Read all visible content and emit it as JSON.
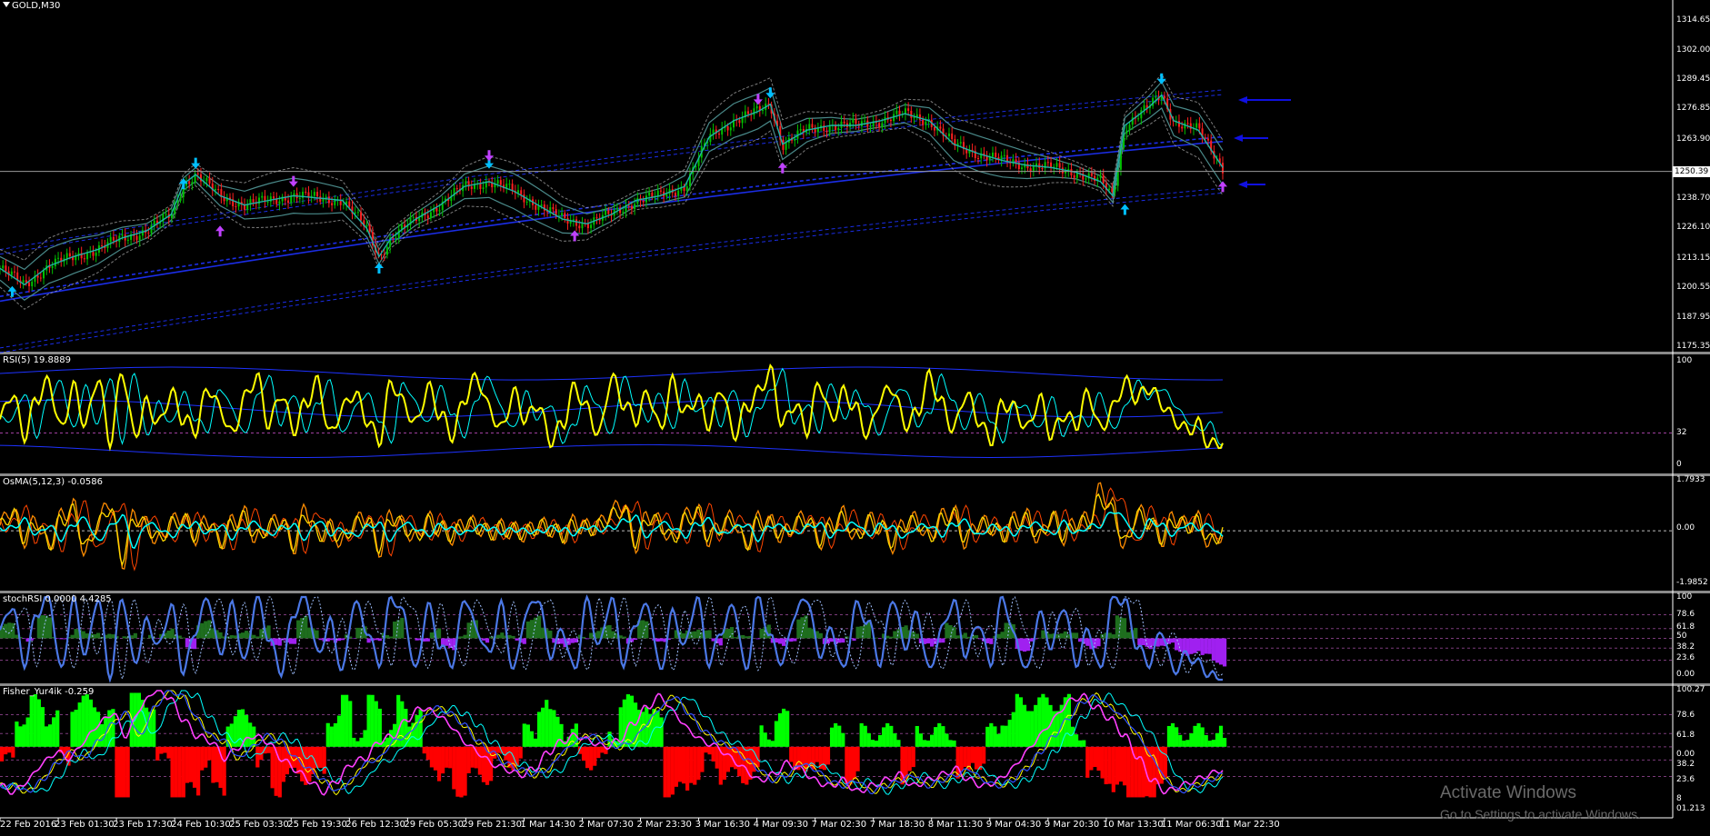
{
  "symbol_label": "GOLD,M30",
  "price_now_label": "1250.39",
  "watermark": {
    "line1": "Activate Windows",
    "line2": "Go to Settings to activate Windows."
  },
  "icons": {
    "symbol_menu": "triangle-down-icon",
    "arrow_up": "arrow-up-icon",
    "arrow_down": "arrow-down-icon",
    "blue_pointer": "arrow-left-icon"
  },
  "colors": {
    "background": "#000000",
    "candle_up": "#00c000",
    "candle_down": "#ff2020",
    "rsi_line": "#ffff00",
    "signal_cyan": "#00ffff",
    "band_blue": "#1e32ff",
    "stoch_line": "#4b78e6",
    "stoch_hist_up": "#1e6e1e",
    "stoch_hist_down": "#a020f0",
    "fisher_hist_up": "#00ff00",
    "fisher_hist_down": "#ff0000",
    "osma_orange": "#ff8c00",
    "arrow_cyan": "#00bfff",
    "arrow_purple": "#c040ff"
  },
  "chart_data": [
    {
      "type": "candlestick",
      "name": "GOLD,M30",
      "ylim": [
        1175.35,
        1322
      ],
      "y_ticks": [
        "1314.65",
        "1302.00",
        "1289.45",
        "1276.85",
        "1263.90",
        "1250.39",
        "1238.70",
        "1226.10",
        "1213.15",
        "1200.55",
        "1187.95",
        "1175.35"
      ],
      "x_ticks": [
        "22 Feb 2016",
        "23 Feb 01:30",
        "23 Feb 17:30",
        "24 Feb 10:30",
        "25 Feb 03:30",
        "25 Feb 19:30",
        "26 Feb 12:30",
        "29 Feb 05:30",
        "29 Feb 21:30",
        "1 Mar 14:30",
        "2 Mar 07:30",
        "2 Mar 23:30",
        "3 Mar 16:30",
        "4 Mar 09:30",
        "7 Mar 02:30",
        "7 Mar 18:30",
        "8 Mar 11:30",
        "9 Mar 04:30",
        "9 Mar 20:30",
        "10 Mar 13:30",
        "11 Mar 06:30",
        "11 Mar 22:30"
      ],
      "close_path": [
        [
          0,
          1209
        ],
        [
          2,
          1202
        ],
        [
          4,
          1210
        ],
        [
          6,
          1214
        ],
        [
          8,
          1217
        ],
        [
          10,
          1222
        ],
        [
          12,
          1225
        ],
        [
          14,
          1232
        ],
        [
          15,
          1245
        ],
        [
          16,
          1249
        ],
        [
          18,
          1240
        ],
        [
          20,
          1236
        ],
        [
          22,
          1238
        ],
        [
          24,
          1240
        ],
        [
          26,
          1239
        ],
        [
          28,
          1238
        ],
        [
          30,
          1226
        ],
        [
          31,
          1214
        ],
        [
          32,
          1222
        ],
        [
          34,
          1230
        ],
        [
          36,
          1236
        ],
        [
          38,
          1244
        ],
        [
          40,
          1246
        ],
        [
          42,
          1242
        ],
        [
          44,
          1236
        ],
        [
          46,
          1230
        ],
        [
          48,
          1228
        ],
        [
          50,
          1232
        ],
        [
          52,
          1238
        ],
        [
          54,
          1240
        ],
        [
          56,
          1244
        ],
        [
          58,
          1265
        ],
        [
          60,
          1272
        ],
        [
          62,
          1276
        ],
        [
          63,
          1279
        ],
        [
          64,
          1262
        ],
        [
          66,
          1268
        ],
        [
          68,
          1270
        ],
        [
          70,
          1270
        ],
        [
          72,
          1272
        ],
        [
          74,
          1275
        ],
        [
          76,
          1272
        ],
        [
          78,
          1262
        ],
        [
          80,
          1258
        ],
        [
          82,
          1255
        ],
        [
          84,
          1253
        ],
        [
          86,
          1252
        ],
        [
          88,
          1250
        ],
        [
          90,
          1246
        ],
        [
          91,
          1240
        ],
        [
          92,
          1270
        ],
        [
          94,
          1278
        ],
        [
          95,
          1283
        ],
        [
          96,
          1272
        ],
        [
          98,
          1268
        ],
        [
          99,
          1260
        ],
        [
          100,
          1252
        ]
      ],
      "up_arrows": [
        [
          1,
          1203
        ],
        [
          15,
          1249
        ],
        [
          31,
          1213
        ],
        [
          92,
          1238
        ]
      ],
      "down_arrows": [
        [
          16,
          1250
        ],
        [
          40,
          1250
        ],
        [
          63,
          1280
        ],
        [
          95,
          1286
        ]
      ],
      "purple_up": [
        [
          18,
          1228
        ],
        [
          47,
          1226
        ],
        [
          64,
          1255
        ],
        [
          100,
          1247
        ]
      ],
      "purple_down": [
        [
          24,
          1243
        ],
        [
          40,
          1254
        ],
        [
          62,
          1278
        ]
      ]
    },
    {
      "type": "line",
      "name": "RSI(5)",
      "label": "RSI(5) 19.8889",
      "ylim": [
        0,
        100
      ],
      "y_ticks": [
        "100",
        "32",
        "0"
      ],
      "levels": [
        32
      ],
      "series": [
        {
          "values": [
            45,
            70,
            30,
            65,
            80,
            35,
            75,
            40,
            85,
            25,
            90,
            30,
            60,
            40,
            70,
            45,
            35,
            75,
            55,
            30,
            65,
            85,
            40,
            70,
            35,
            60,
            80,
            30,
            55,
            70,
            45,
            25,
            80,
            60,
            40,
            75,
            50,
            30,
            65,
            85,
            55,
            35,
            70,
            45,
            60,
            25,
            40,
            75,
            55,
            30,
            85,
            60,
            45,
            70,
            35,
            80,
            50,
            65,
            40,
            75,
            30,
            55,
            70,
            90,
            40,
            60,
            35,
            80,
            45,
            70,
            55,
            30,
            65,
            75,
            40,
            50,
            85,
            60,
            35,
            70,
            45,
            25,
            60,
            55,
            35,
            65,
            30,
            50,
            40,
            70,
            35,
            55,
            80,
            65,
            75,
            60,
            45,
            35,
            40,
            20,
            25
          ]
        }
      ]
    },
    {
      "type": "line",
      "name": "OsMA(5,12,3)",
      "label": "OsMA(5,12,3) -0.0586",
      "ylim": [
        -1.9852,
        1.7933
      ],
      "y_ticks": [
        "1.7933",
        "0.00",
        "-1.9852"
      ],
      "levels": [
        0
      ],
      "series": [
        {
          "values": [
            0.2,
            0.8,
            -0.3,
            0.4,
            -0.6,
            0.5,
            0.9,
            -0.8,
            0.3,
            1.1,
            -1.2,
            0.6,
            0.2,
            -0.4,
            0.3,
            0.5,
            -0.2,
            0.4,
            -0.5,
            0.3,
            0.6,
            -0.3,
            0.2,
            0.4,
            -0.6,
            0.8,
            -0.2,
            0.1,
            -0.4,
            0.3,
            0.5,
            -0.7,
            0.6,
            0.2,
            -0.3,
            0.4,
            0.1,
            -0.2,
            0.3,
            0.2,
            -0.1,
            0.1,
            0.0,
            -0.1,
            0.2,
            0.1,
            -0.2,
            0.3,
            0.1,
            0.2,
            0.7,
            1.0,
            -0.5,
            0.6,
            0.3,
            -0.4,
            0.5,
            0.8,
            -0.3,
            0.2,
            0.5,
            -0.6,
            0.4,
            0.3,
            -0.2,
            0.3,
            0.5,
            -0.4,
            0.2,
            0.6,
            -0.3,
            0.4,
            0.2,
            -0.5,
            0.3,
            0.4,
            -0.3,
            0.5,
            0.7,
            -0.4,
            0.3,
            0.2,
            -0.2,
            0.4,
            0.5,
            -0.3,
            0.6,
            -0.2,
            0.3,
            0.4,
            1.5,
            0.9,
            -0.6,
            0.7,
            0.4,
            -0.3,
            0.5,
            0.2,
            0.4,
            -0.5,
            -0.06
          ]
        }
      ]
    },
    {
      "type": "line",
      "name": "stochRSI",
      "label": "stochRSI 0.0000 4.4285",
      "ylim": [
        0,
        100
      ],
      "y_ticks": [
        "100",
        "78.6",
        "61.8",
        "50",
        "38.2",
        "23.6",
        "0.00"
      ],
      "levels": [
        78.6,
        61.8,
        50,
        38.2,
        23.6
      ],
      "series": [
        {
          "values": [
            60,
            90,
            20,
            80,
            100,
            10,
            95,
            30,
            100,
            5,
            100,
            20,
            70,
            40,
            90,
            10,
            60,
            100,
            30,
            90,
            20,
            100,
            50,
            10,
            80,
            100,
            30,
            70,
            10,
            95,
            60,
            20,
            100,
            80,
            10,
            90,
            40,
            20,
            100,
            60,
            30,
            90,
            10,
            80,
            100,
            30,
            60,
            10,
            95,
            40,
            100,
            20,
            70,
            90,
            10,
            80,
            40,
            100,
            20,
            60,
            90,
            10,
            100,
            50,
            20,
            80,
            100,
            30,
            60,
            10,
            90,
            70,
            20,
            100,
            40,
            80,
            10,
            60,
            95,
            30,
            70,
            20,
            100,
            50,
            10,
            80,
            40,
            90,
            20,
            60,
            10,
            100,
            95,
            40,
            20,
            60,
            10,
            30,
            20,
            5,
            0
          ]
        }
      ]
    },
    {
      "type": "line",
      "name": "Fisher_Yur4ik",
      "label": "Fisher_Yur4ik -0.259",
      "ylim": [
        -10,
        100
      ],
      "y_ticks": [
        "100.27",
        "78.6",
        "61.8",
        "0.00",
        "38.2",
        "23.6",
        "8",
        "01.213"
      ],
      "levels": [
        78.6,
        61.8,
        50,
        38.2,
        23.6
      ],
      "series": [
        {
          "values": [
            15,
            10,
            20,
            35,
            45,
            40,
            55,
            70,
            80,
            60,
            85,
            100,
            95,
            75,
            60,
            55,
            40,
            50,
            60,
            55,
            40,
            30,
            20,
            10,
            20,
            35,
            40,
            55,
            60,
            75,
            85,
            80,
            70,
            55,
            45,
            35,
            30,
            25,
            30,
            45,
            55,
            60,
            55,
            50,
            55,
            70,
            85,
            95,
            80,
            65,
            55,
            50,
            40,
            30,
            20,
            25,
            35,
            30,
            20,
            15,
            20,
            10,
            15,
            20,
            25,
            15,
            20,
            25,
            30,
            20,
            15,
            20,
            30,
            45,
            60,
            75,
            90,
            95,
            85,
            75,
            60,
            40,
            20,
            10,
            15,
            20,
            25,
            30
          ]
        }
      ]
    }
  ]
}
